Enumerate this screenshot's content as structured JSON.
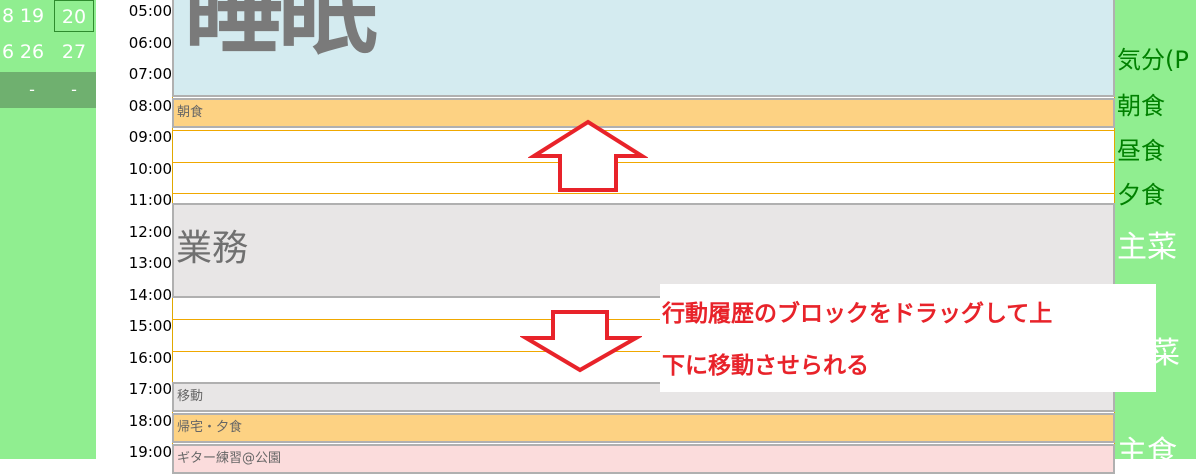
{
  "calendar": {
    "row1": [
      "8",
      "19",
      "20"
    ],
    "row2": [
      "6",
      "26",
      "27"
    ],
    "dashes": [
      "-",
      "-"
    ]
  },
  "times": [
    "05:00",
    "06:00",
    "07:00",
    "08:00",
    "09:00",
    "10:00",
    "11:00",
    "12:00",
    "13:00",
    "14:00",
    "15:00",
    "16:00",
    "17:00",
    "18:00",
    "19:00"
  ],
  "blocks": {
    "sleep_label": "睡眠",
    "breakfast": "朝食",
    "work": "業務",
    "move": "移動",
    "home_dinner": "帰宅・夕食",
    "guitar": "ギター練習@公園"
  },
  "right_panel": {
    "mood": "気分(P",
    "breakfast": "朝食",
    "lunch": "昼食",
    "dinner": "夕食",
    "main_dish1": "主菜",
    "side_dish": "菜",
    "staple": "主食"
  },
  "annotation": {
    "line1": "行動履歴のブロックをドラッグして上",
    "line2": "下に移動させられる"
  },
  "colors": {
    "sidebar": "#90ee90",
    "sleep": "#d4ebf0",
    "meal": "#fdd283",
    "work": "#e8e6e6",
    "guitar": "#fbdcdc",
    "arrow": "#e8232a"
  }
}
